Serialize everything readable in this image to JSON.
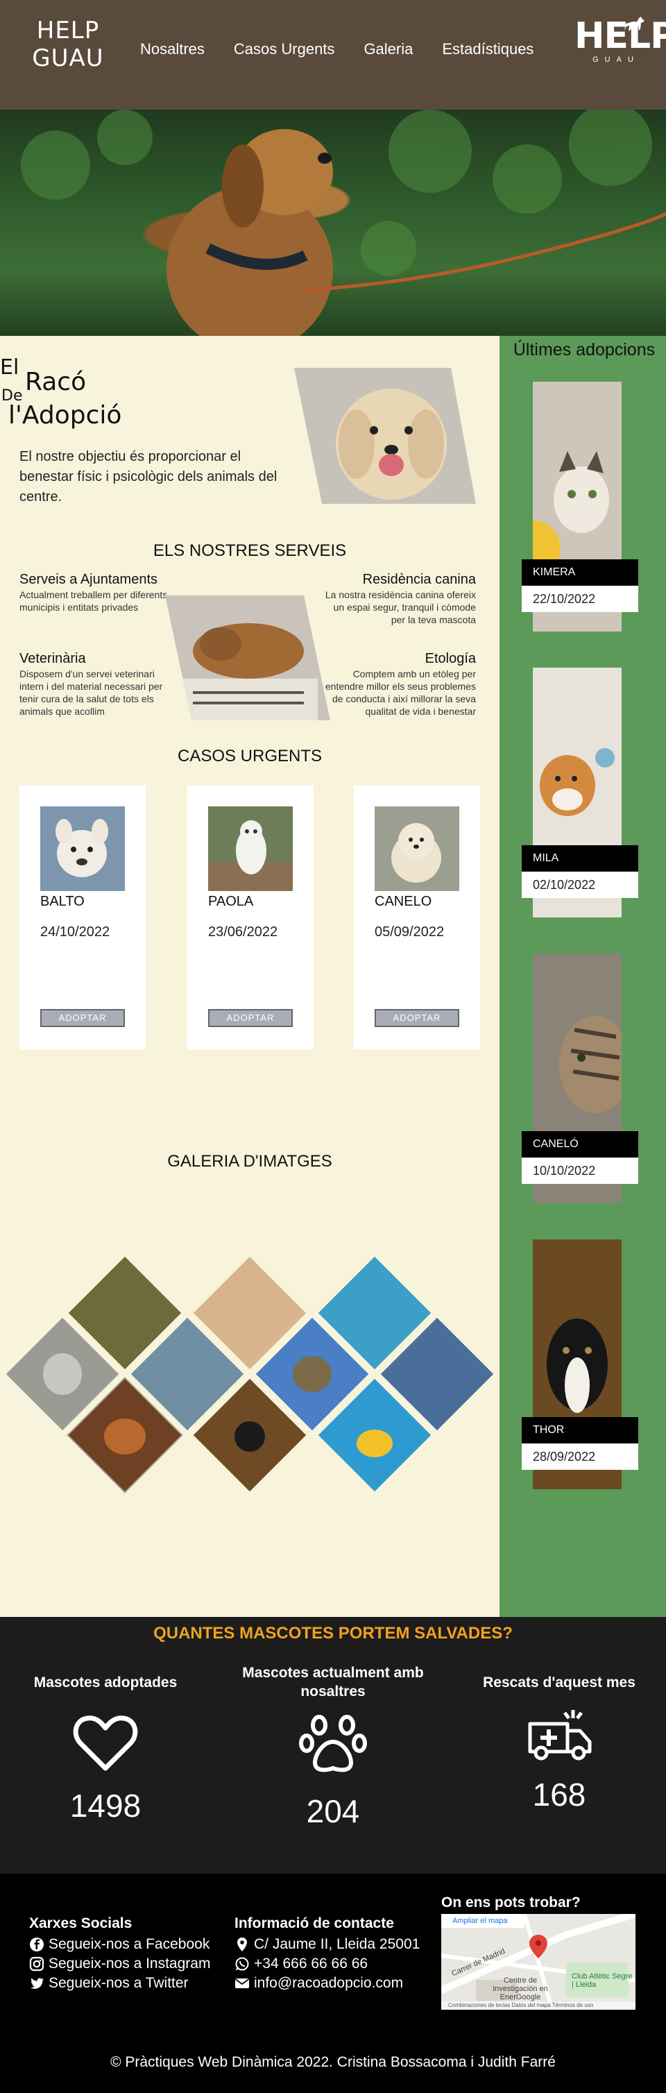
{
  "header": {
    "logo_line1": "HELP",
    "logo_line2": "GUAU",
    "nav": [
      "Nosaltres",
      "Casos Urgents",
      "Galeria",
      "Estadístiques"
    ],
    "brand_big": "HELP",
    "brand_small": "GUAU"
  },
  "intro": {
    "title_el": "El",
    "title_raco": "Racó",
    "title_de": "De",
    "title_adopcio": "l'Adopció",
    "text": "El nostre objectiu és proporcionar el benestar físic i psicològic dels animals del centre."
  },
  "services": {
    "title": "ELS NOSTRES SERVEIS",
    "items": [
      {
        "title": "Serveis a Ajuntaments",
        "text": "Actualment treballem per diferents municipis i entitats privades"
      },
      {
        "title": "Residència canina",
        "text": "La nostra residència canina ofereix un espai segur, tranquil i còmode per la teva mascota"
      },
      {
        "title": "Veterinària",
        "text": "Disposem d'un servei veterinari intern i del material necessari per tenir cura de la salut de tots els animals que acollim"
      },
      {
        "title": "Etología",
        "text": "Comptem amb un etòleg per entendre millor els seus problemes de conducta i així millorar la seva qualitat de vida i benestar"
      }
    ]
  },
  "urgent": {
    "title": "CASOS URGENTS",
    "cards": [
      {
        "name": "BALTO",
        "date": "24/10/2022",
        "button": "ADOPTAR"
      },
      {
        "name": "PAOLA",
        "date": "23/06/2022",
        "button": "ADOPTAR"
      },
      {
        "name": "CANELO",
        "date": "05/09/2022",
        "button": "ADOPTAR"
      }
    ]
  },
  "gallery": {
    "title": "GALERIA D'IMATGES"
  },
  "sidebar": {
    "title": "Últimes adopcions",
    "items": [
      {
        "name": "KIMERA",
        "date": "22/10/2022"
      },
      {
        "name": "MILA",
        "date": "02/10/2022"
      },
      {
        "name": "CANELÓ",
        "date": "10/10/2022"
      },
      {
        "name": "THOR",
        "date": "28/09/2022"
      }
    ]
  },
  "stats": {
    "title": "QUANTES MASCOTES PORTEM SALVADES?",
    "items": [
      {
        "label": "Mascotes adoptades",
        "value": "1498",
        "icon": "heart-icon"
      },
      {
        "label": "Mascotes actualment amb nosaltres",
        "value": "204",
        "icon": "paw-icon"
      },
      {
        "label": "Rescats d'aquest mes",
        "value": "168",
        "icon": "ambulance-icon"
      }
    ],
    "accent": "#f0a21f"
  },
  "footer": {
    "social_title": "Xarxes Socials",
    "social": [
      "Segueix-nos a Facebook",
      "Segueix-nos a Instagram",
      "Segueix-nos a Twitter"
    ],
    "contact_title": "Informació de contacte",
    "contact": [
      "C/ Jaume II, Lleida 25001",
      "+34 666 66 66 66",
      "info@racoadopcio.com"
    ],
    "map_title": "On ens pots trobar?",
    "map_link": "Ampliar el mapa",
    "map_labels": [
      "Carrer de Madrid",
      "Centre de Investigación en EnerGoogle",
      "Club Atlètic Segre | Lleida"
    ],
    "map_footer": "Combinaciones de teclas   Datos del mapa   Términos de uso",
    "copyright": "© Pràctiques Web Dinàmica 2022. Cristina Bossacoma i Judith Farré"
  }
}
